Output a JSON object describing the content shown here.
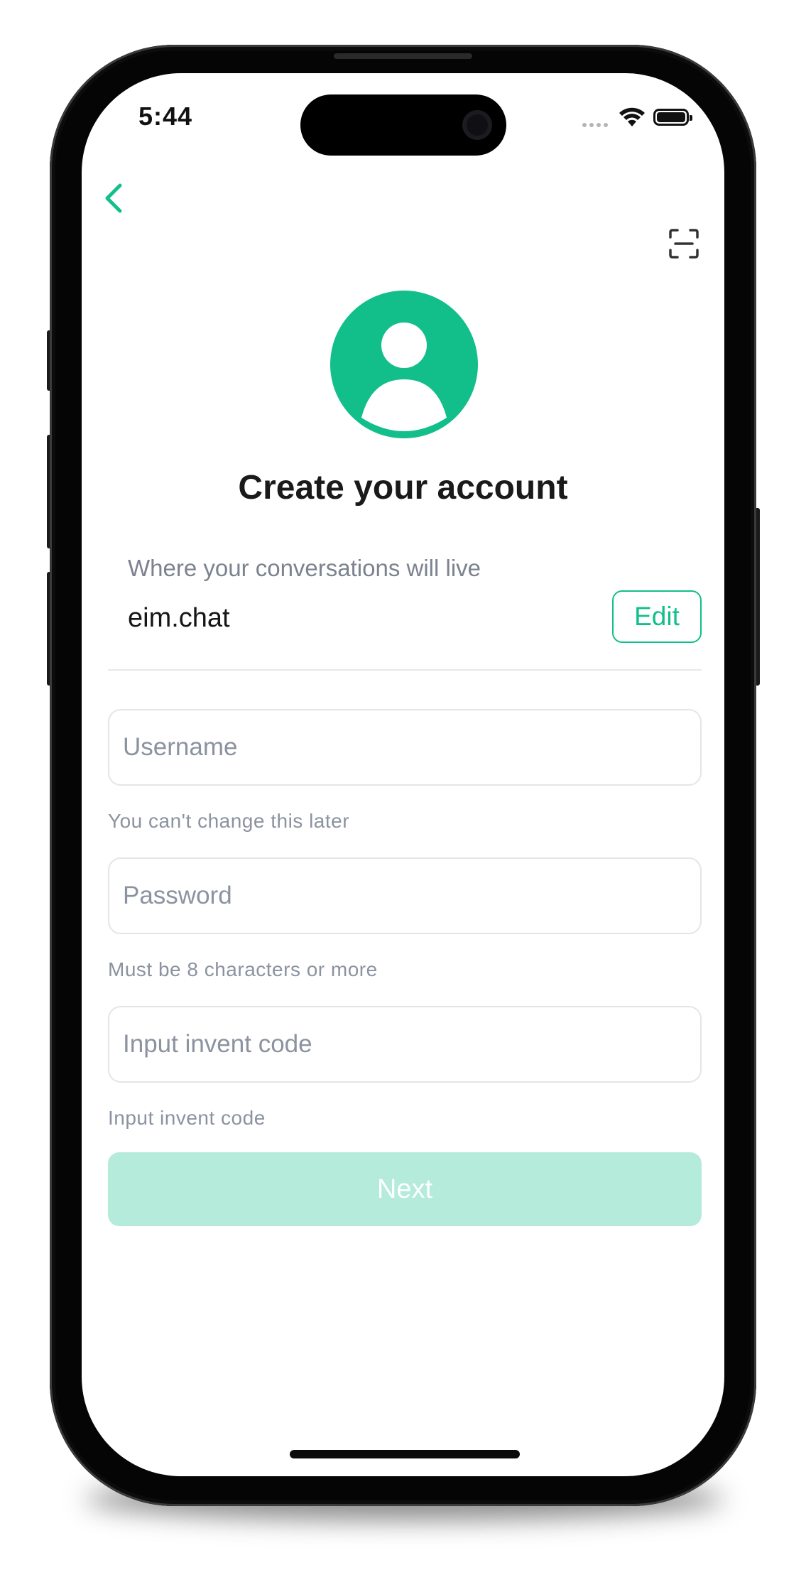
{
  "status_bar": {
    "time": "5:44",
    "icons": [
      "cellular-signal-icon",
      "wifi-icon",
      "battery-icon"
    ]
  },
  "nav": {
    "back_icon": "chevron-left-icon",
    "scan_icon": "scan-icon"
  },
  "header": {
    "avatar_icon": "user-avatar-icon",
    "title": "Create your account"
  },
  "server": {
    "caption": "Where your conversations will live",
    "name": "eim.chat",
    "edit_label": "Edit"
  },
  "form": {
    "username": {
      "value": "",
      "placeholder": "Username",
      "hint": "You can't change this later"
    },
    "password": {
      "value": "",
      "placeholder": "Password",
      "hint": "Must be 8 characters or more"
    },
    "invite": {
      "value": "",
      "placeholder": "Input invent code",
      "hint": "Input invent code"
    },
    "next_label": "Next"
  },
  "colors": {
    "accent": "#12bf8b",
    "button_disabled": "#b4ebdb",
    "hint_text": "#8b92a0",
    "title_text": "#1a1a1a"
  }
}
